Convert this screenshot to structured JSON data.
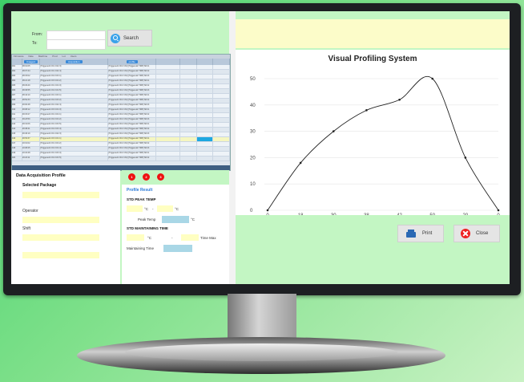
{
  "search": {
    "from_label": "From:",
    "to_label": "To:",
    "from_value": "",
    "to_value": "",
    "button_label": "Search"
  },
  "grid": {
    "header_pill_1": "Unagent",
    "header_pill_2": "Acquisition",
    "header_pill_3": "profile",
    "tabs": [
      "Firmware",
      "Date",
      "Machine",
      "Prod",
      "Lot",
      "Users"
    ],
    "rows": [
      {
        "no": "001",
        "time": "08:01:05",
        "info": "[Triggered1 Ch1 Ch2 3]",
        "info2": "[Triggered1 Ch2 Ch4] [Triggered2 TMP] ShC1"
      },
      {
        "no": "002",
        "time": "08:07:44",
        "info": "[Triggered1 Ch1 Ch2 4]",
        "info2": "[Triggered1 Ch2 Ch4] [Triggered2 TMP] ShC2"
      },
      {
        "no": "003",
        "time": "08:15:02",
        "info": "[Triggered1 Ch2 Ch3 1]",
        "info2": "[Triggered1 Ch2 Ch4] [Triggered2 TMP] ShC3"
      },
      {
        "no": "004",
        "time": "08:21:18",
        "info": "[Triggered1 Ch3 Ch4 2]",
        "info2": "[Triggered1 Ch2 Ch4] [Triggered2 TMP] ShC1"
      },
      {
        "no": "005",
        "time": "08:29:40",
        "info": "[Triggered1 Ch1 Ch4 3]",
        "info2": "[Triggered1 Ch2 Ch4] [Triggered2 TMP] ShC2"
      },
      {
        "no": "006",
        "time": "08:36:55",
        "info": "[Triggered1 Ch2 Ch4 5]",
        "info2": "[Triggered1 Ch2 Ch4] [Triggered2 TMP] ShC3"
      },
      {
        "no": "007",
        "time": "08:44:10",
        "info": "[Triggered1 Ch1 Ch3 1]",
        "info2": "[Triggered1 Ch2 Ch4] [Triggered2 TMP] ShC1"
      },
      {
        "no": "008",
        "time": "08:52:33",
        "info": "[Triggered1 Ch2 Ch3 2]",
        "info2": "[Triggered1 Ch2 Ch4] [Triggered2 TMP] ShC2"
      },
      {
        "no": "009",
        "time": "09:00:48",
        "info": "[Triggered1 Ch1 Ch2 4]",
        "info2": "[Triggered1 Ch2 Ch4] [Triggered2 TMP] ShC3"
      },
      {
        "no": "010",
        "time": "09:08:12",
        "info": "[Triggered1 Ch3 Ch4 3]",
        "info2": "[Triggered1 Ch2 Ch4] [Triggered2 TMP] ShC1"
      },
      {
        "no": "011",
        "time": "09:15:27",
        "info": "[Triggered1 Ch1 Ch4 1]",
        "info2": "[Triggered1 Ch2 Ch4] [Triggered2 TMP] ShC2"
      },
      {
        "no": "012",
        "time": "09:23:50",
        "info": "[Triggered1 Ch2 Ch4 2]",
        "info2": "[Triggered1 Ch2 Ch4] [Triggered2 TMP] ShC3"
      },
      {
        "no": "013",
        "time": "09:31:06",
        "info": "[Triggered1 Ch1 Ch3 5]",
        "info2": "[Triggered1 Ch2 Ch4] [Triggered2 TMP] ShC1"
      },
      {
        "no": "014",
        "time": "09:38:41",
        "info": "[Triggered1 Ch2 Ch3 4]",
        "info2": "[Triggered1 Ch2 Ch4] [Triggered2 TMP] ShC2"
      },
      {
        "no": "015",
        "time": "09:46:19",
        "info": "[Triggered1 Ch1 Ch2 3]",
        "info2": "[Triggered1 Ch2 Ch4] [Triggered2 TMP] ShC3"
      },
      {
        "no": "016",
        "time": "09:53:37",
        "info": "[Triggered1 Ch3 Ch4 1]",
        "info2": "[Triggered1 Ch2 Ch4] [Triggered2 TMP] ShC1"
      },
      {
        "no": "017",
        "time": "10:01:02",
        "info": "[Triggered1 Ch1 Ch4 2]",
        "info2": "[Triggered1 Ch2 Ch4] [Triggered2 TMP] ShC2"
      },
      {
        "no": "018",
        "time": "10:08:25",
        "info": "[Triggered1 Ch2 Ch4 4]",
        "info2": "[Triggered1 Ch2 Ch4] [Triggered2 TMP] ShC3"
      },
      {
        "no": "019",
        "time": "10:16:48",
        "info": "[Triggered1 Ch1 Ch3 3]",
        "info2": "[Triggered1 Ch2 Ch4] [Triggered2 TMP] ShC1"
      },
      {
        "no": "020",
        "time": "10:24:11",
        "info": "[Triggered1 Ch2 Ch3 5]",
        "info2": "[Triggered1 Ch2 Ch4] [Triggered2 TMP] ShC2"
      }
    ]
  },
  "dap": {
    "title": "Data Acquisition Profile",
    "selected_package": "Selected Package",
    "operator": "Operator",
    "shift": "Shift"
  },
  "profile": {
    "tabs": [
      "1",
      "2",
      "3"
    ],
    "title": "Profile Result",
    "std_peak_temp": "STD PEAK TEMP",
    "unit_c": "°C",
    "dash": "-",
    "peak_temp": "Peak Temp",
    "std_maint_time": "STD MAINTAINING TIME",
    "time_max": "Time Max",
    "maint_time": "Maintaining Time"
  },
  "chart_data": {
    "type": "line",
    "title": "Visual Profiling System",
    "categories": [
      "0",
      "18",
      "30",
      "38",
      "42",
      "50",
      "20",
      "0"
    ],
    "values": [
      0,
      18,
      30,
      38,
      42,
      50,
      20,
      0
    ],
    "ylim": [
      0,
      50
    ],
    "yticks": [
      0,
      10,
      20,
      30,
      40,
      50
    ],
    "grid": true,
    "colors": {
      "line": "#222222",
      "grid": "#e6e6e6"
    }
  },
  "actions": {
    "print_label": "Print",
    "close_label": "Close"
  }
}
